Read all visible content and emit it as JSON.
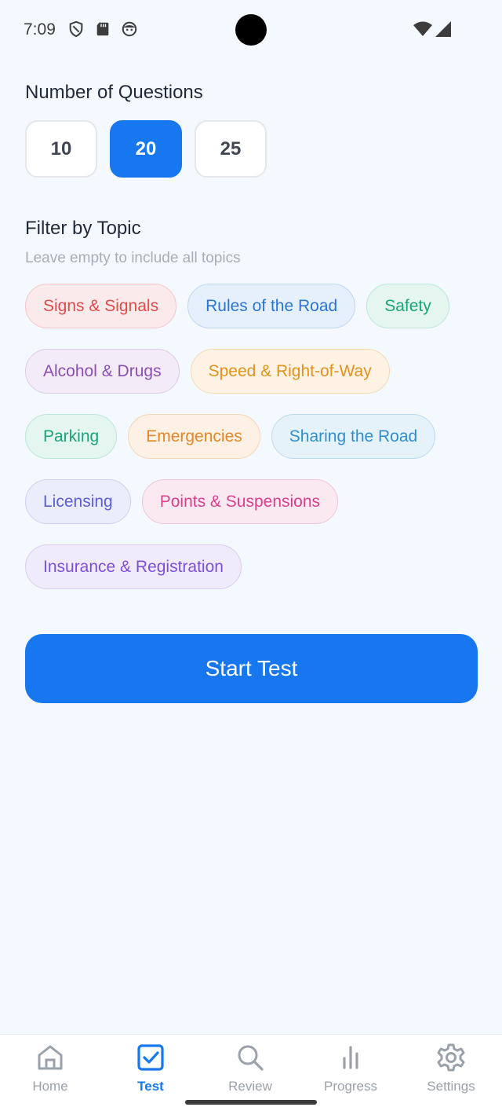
{
  "status_bar": {
    "time": "7:09",
    "icons": [
      "shield-icon",
      "sd-card-icon",
      "face-icon",
      "wifi-icon",
      "signal-icon"
    ]
  },
  "questions": {
    "title": "Number of Questions",
    "options": [
      "10",
      "20",
      "25"
    ],
    "selected": "20"
  },
  "filter": {
    "title": "Filter by Topic",
    "subtitle": "Leave empty to include all topics",
    "topics": [
      {
        "label": "Signs & Signals",
        "color": "#e34a4a",
        "bg": "#fbeaec",
        "border": "#f4c6ca"
      },
      {
        "label": "Rules of the Road",
        "color": "#2a76d2",
        "bg": "#e6f0fc",
        "border": "#bcd6f5"
      },
      {
        "label": "Safety",
        "color": "#17a679",
        "bg": "#e4f6ef",
        "border": "#b9e8d8"
      },
      {
        "label": "Alcohol & Drugs",
        "color": "#8b4fb1",
        "bg": "#f3ebf7",
        "border": "#dccbe9"
      },
      {
        "label": "Speed & Right-of-Way",
        "color": "#e3921a",
        "bg": "#fdf2e4",
        "border": "#f6d9b2"
      },
      {
        "label": "Parking",
        "color": "#1ba27c",
        "bg": "#e4f6ef",
        "border": "#b9e8d8"
      },
      {
        "label": "Emergencies",
        "color": "#e38727",
        "bg": "#fdf0e4",
        "border": "#f5d6b6"
      },
      {
        "label": "Sharing the Road",
        "color": "#2f8fcc",
        "bg": "#e6f2fa",
        "border": "#bcdaef"
      },
      {
        "label": "Licensing",
        "color": "#5b5fd6",
        "bg": "#ecedfb",
        "border": "#cfd1f3"
      },
      {
        "label": "Points & Suspensions",
        "color": "#dc3f8c",
        "bg": "#fbe9f2",
        "border": "#f2c5da"
      },
      {
        "label": "Insurance & Registration",
        "color": "#7c4fd8",
        "bg": "#f0ebfb",
        "border": "#d8cdf3"
      }
    ]
  },
  "start_label": "Start Test",
  "nav": {
    "items": [
      {
        "label": "Home",
        "icon": "home-icon"
      },
      {
        "label": "Test",
        "icon": "checkbox-icon"
      },
      {
        "label": "Review",
        "icon": "search-icon"
      },
      {
        "label": "Progress",
        "icon": "bar-chart-icon"
      },
      {
        "label": "Settings",
        "icon": "gear-icon"
      }
    ],
    "active": "Test"
  },
  "colors": {
    "accent": "#1677ee",
    "background": "#f4f8ff",
    "inactive": "#9aa1ab"
  }
}
